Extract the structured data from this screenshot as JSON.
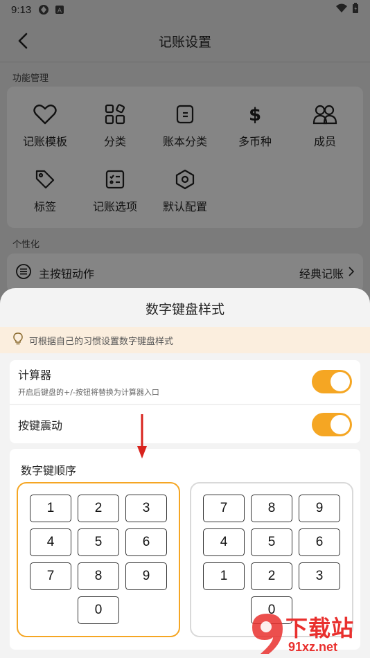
{
  "status_bar": {
    "time": "9:13"
  },
  "nav": {
    "title": "记账设置"
  },
  "sections": {
    "functions": "功能管理",
    "personalize": "个性化"
  },
  "functions": [
    {
      "label": "记账模板",
      "icon": "heart-icon"
    },
    {
      "label": "分类",
      "icon": "category-icon"
    },
    {
      "label": "账本分类",
      "icon": "book-icon"
    },
    {
      "label": "多币种",
      "icon": "dollar-icon"
    },
    {
      "label": "成员",
      "icon": "members-icon"
    },
    {
      "label": "标签",
      "icon": "tag-icon"
    },
    {
      "label": "记账选项",
      "icon": "checklist-icon"
    },
    {
      "label": "默认配置",
      "icon": "settings-hex-icon"
    }
  ],
  "main_button": {
    "label": "主按钮动作",
    "value": "经典记账"
  },
  "sheet": {
    "title": "数字键盘样式",
    "tip": "可根据自己的习惯设置数字键盘样式",
    "calculator": {
      "label": "计算器",
      "desc": "开启后键盘的+/-按钮将替换为计算器入口",
      "on": true
    },
    "vibration": {
      "label": "按键震动",
      "on": true
    },
    "order": {
      "title": "数字键顺序",
      "pad_a": [
        "1",
        "2",
        "3",
        "4",
        "5",
        "6",
        "7",
        "8",
        "9",
        "0"
      ],
      "pad_b": [
        "7",
        "8",
        "9",
        "4",
        "5",
        "6",
        "1",
        "2",
        "3",
        "0"
      ],
      "selected": "pad_a"
    }
  },
  "watermark": {
    "big": "下载站",
    "small": "91xz.net"
  },
  "colors": {
    "accent": "#f5a623",
    "tip_bg": "#fbeede",
    "watermark": "#e9302e"
  }
}
